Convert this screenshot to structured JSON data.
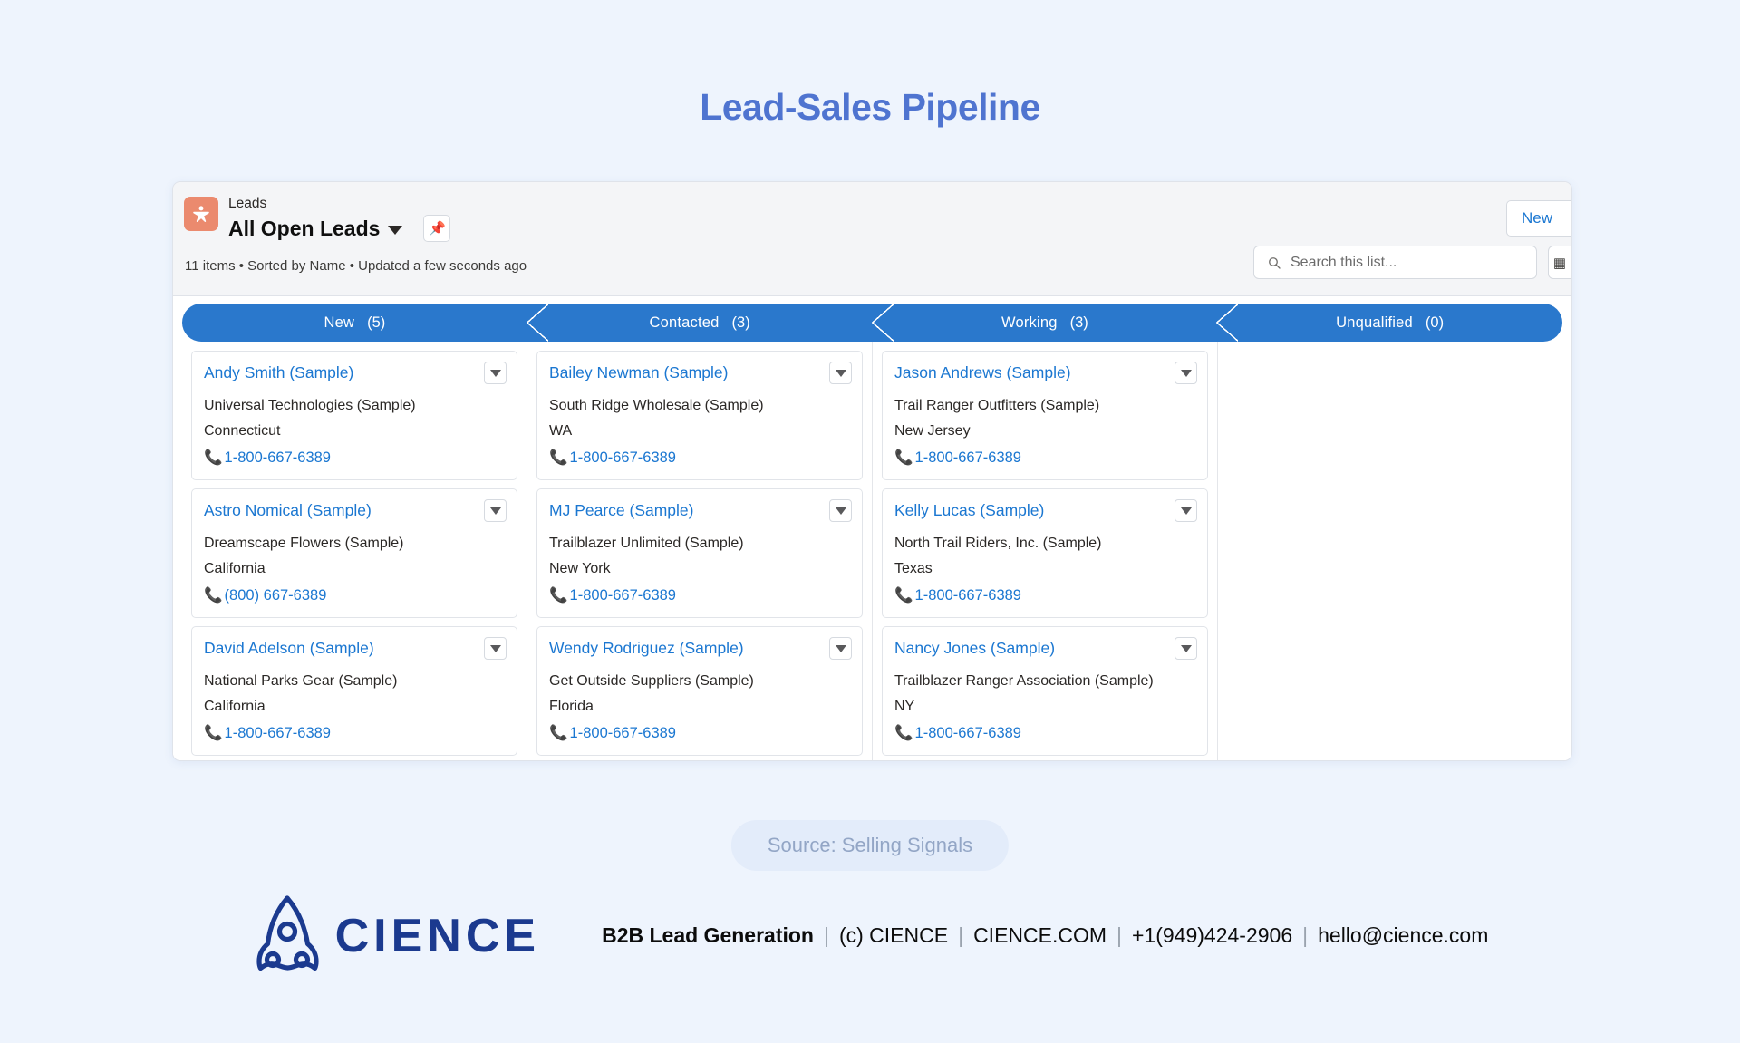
{
  "page": {
    "title": "Lead-Sales Pipeline",
    "title_color": "#4f74d0",
    "background_color": "#eef4fd"
  },
  "listview": {
    "object_label": "Leads",
    "list_name": "All Open Leads",
    "caret_icon": "chevron-down-icon",
    "pin_icon": "pin-icon",
    "meta": "11 items • Sorted by Name • Updated a few seconds ago",
    "new_button": "New",
    "search": {
      "placeholder": "Search this list...",
      "value": "",
      "icon": "search-icon"
    },
    "tool_button_icon": "list-settings-icon",
    "app_icon": "leads-person-icon",
    "app_icon_color": "#eb8a6e"
  },
  "kanban": {
    "stage_color": "#2a78cc",
    "stages": [
      {
        "label": "New",
        "count": "(5)"
      },
      {
        "label": "Contacted",
        "count": "(3)"
      },
      {
        "label": "Working",
        "count": "(3)"
      },
      {
        "label": "Unqualified",
        "count": "(0)"
      }
    ],
    "columns": [
      {
        "stage": "New",
        "cards": [
          {
            "name": "Andy Smith (Sample)",
            "company": "Universal Technologies (Sample)",
            "location": "Connecticut",
            "phone": "1-800-667-6389"
          },
          {
            "name": "Astro Nomical (Sample)",
            "company": "Dreamscape Flowers (Sample)",
            "location": "California",
            "phone": "(800) 667-6389"
          },
          {
            "name": "David Adelson (Sample)",
            "company": "National Parks Gear (Sample)",
            "location": "California",
            "phone": "1-800-667-6389"
          }
        ]
      },
      {
        "stage": "Contacted",
        "cards": [
          {
            "name": "Bailey Newman (Sample)",
            "company": "South Ridge Wholesale (Sample)",
            "location": "WA",
            "phone": "1-800-667-6389"
          },
          {
            "name": "MJ Pearce (Sample)",
            "company": "Trailblazer Unlimited (Sample)",
            "location": "New York",
            "phone": "1-800-667-6389"
          },
          {
            "name": "Wendy Rodriguez (Sample)",
            "company": "Get Outside Suppliers (Sample)",
            "location": "Florida",
            "phone": "1-800-667-6389"
          }
        ]
      },
      {
        "stage": "Working",
        "cards": [
          {
            "name": "Jason Andrews (Sample)",
            "company": "Trail Ranger Outfitters (Sample)",
            "location": "New Jersey",
            "phone": "1-800-667-6389"
          },
          {
            "name": "Kelly Lucas (Sample)",
            "company": "North Trail Riders, Inc. (Sample)",
            "location": "Texas",
            "phone": "1-800-667-6389"
          },
          {
            "name": "Nancy Jones (Sample)",
            "company": "Trailblazer Ranger Association (Sample)",
            "location": "NY",
            "phone": "1-800-667-6389"
          }
        ]
      },
      {
        "stage": "Unqualified",
        "cards": []
      }
    ],
    "card_menu_icon": "chevron-down-icon",
    "phone_icon": "phone-icon"
  },
  "source": {
    "label": "Source: Selling Signals"
  },
  "footer": {
    "logo_icon": "rocket-icon",
    "logo_text": "CIENCE",
    "logo_color": "#1b3a8f",
    "tagline": "B2B Lead Generation",
    "copyright": "(c) CIENCE",
    "website": "CIENCE.COM",
    "phone": "+1(949)424-2906",
    "email": "hello@cience.com"
  }
}
